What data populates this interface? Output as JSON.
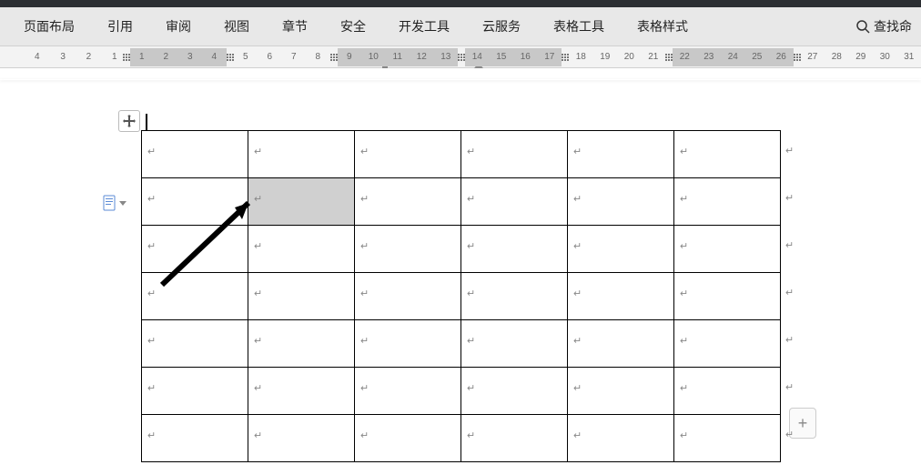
{
  "menubar": {
    "items": [
      {
        "label": "页面布局"
      },
      {
        "label": "引用"
      },
      {
        "label": "审阅"
      },
      {
        "label": "视图"
      },
      {
        "label": "章节"
      },
      {
        "label": "安全"
      },
      {
        "label": "开发工具"
      },
      {
        "label": "云服务"
      },
      {
        "label": "表格工具"
      },
      {
        "label": "表格样式"
      }
    ],
    "search_label": "查找命"
  },
  "ruler": {
    "left_numbers": [
      "4",
      "3",
      "2",
      "1"
    ],
    "right_numbers": [
      "1",
      "2",
      "3",
      "4",
      "5",
      "6",
      "7",
      "8",
      "9",
      "10",
      "11",
      "12",
      "13",
      "14",
      "15",
      "16",
      "17",
      "18",
      "19",
      "20",
      "21",
      "22",
      "23",
      "24",
      "25",
      "26",
      "27",
      "28",
      "29",
      "30",
      "31"
    ]
  },
  "table": {
    "rows": 7,
    "cols": 6,
    "selected": {
      "row": 1,
      "col": 1
    },
    "newline_symbol": "↵"
  },
  "plus_label": "+",
  "paste_icon_name": "paste-options"
}
